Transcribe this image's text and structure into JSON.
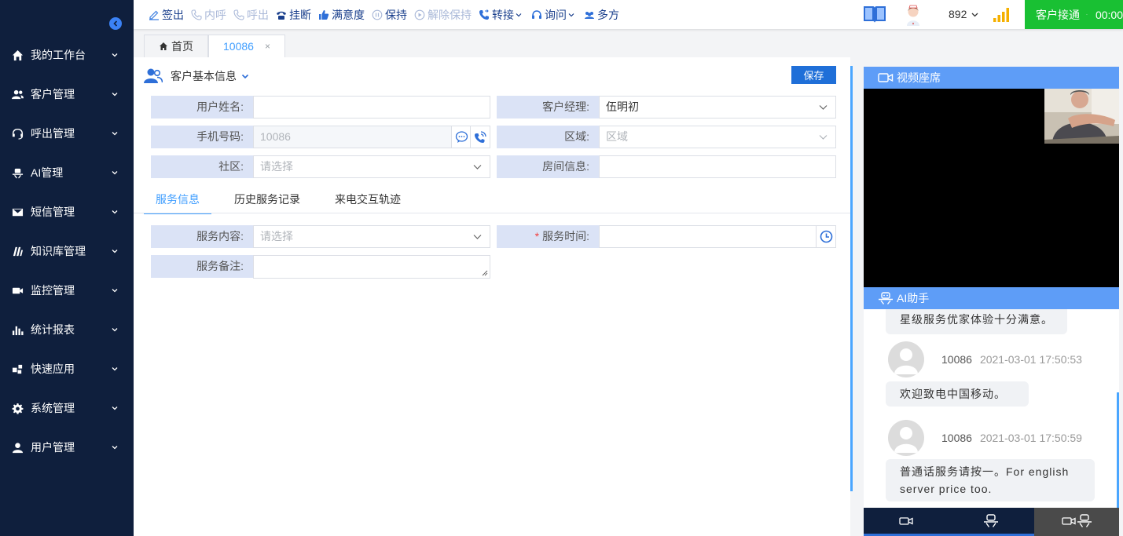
{
  "sidebar": {
    "items": [
      {
        "label": "我的工作台",
        "icon": "home-icon"
      },
      {
        "label": "客户管理",
        "icon": "users-icon"
      },
      {
        "label": "呼出管理",
        "icon": "headset-icon"
      },
      {
        "label": "AI管理",
        "icon": "ai-icon"
      },
      {
        "label": "短信管理",
        "icon": "mail-icon"
      },
      {
        "label": "知识库管理",
        "icon": "knowledge-icon"
      },
      {
        "label": "监控管理",
        "icon": "video-icon"
      },
      {
        "label": "统计报表",
        "icon": "bar-chart-icon"
      },
      {
        "label": "快速应用",
        "icon": "apps-icon"
      },
      {
        "label": "系统管理",
        "icon": "gear-icon"
      },
      {
        "label": "用户管理",
        "icon": "user-icon"
      }
    ]
  },
  "toolbar": {
    "signout": "签出",
    "internal_call": "内呼",
    "outbound_call": "呼出",
    "hangup": "挂断",
    "satisfaction": "满意度",
    "hold": "保持",
    "unhold": "解除保持",
    "transfer": "转接",
    "consult": "询问",
    "conference": "多方",
    "extension": "892",
    "status": "客户接通",
    "timer": "00:00"
  },
  "tabs": [
    {
      "label": "首页"
    },
    {
      "label": "10086",
      "close": "×"
    }
  ],
  "form": {
    "section_title": "客户基本信息",
    "save_label": "保存",
    "username_label": "用户姓名:",
    "username_value": "",
    "manager_label": "客户经理:",
    "manager_value": "伍明初",
    "phone_label": "手机号码:",
    "phone_value": "10086",
    "region_label": "区域:",
    "region_placeholder": "区域",
    "community_label": "社区:",
    "community_placeholder": "请选择",
    "room_label": "房间信息:",
    "room_value": ""
  },
  "sub_tabs": [
    "服务信息",
    "历史服务记录",
    "来电交互轨迹"
  ],
  "service": {
    "content_label": "服务内容:",
    "content_placeholder": "请选择",
    "required_mark": "*",
    "time_label": "服务时间:",
    "time_value": "",
    "remark_label": "服务备注:",
    "remark_value": ""
  },
  "right_panel": {
    "video_title": "视频座席",
    "ai_title": "AI助手",
    "messages": [
      {
        "text": "星级服务优家体验十分满意。"
      },
      {
        "name": "10086",
        "time": "2021-03-01 17:50:53",
        "text": "欢迎致电中国移动。"
      },
      {
        "name": "10086",
        "time": "2021-03-01 17:50:59",
        "text": "普通话服务请按一。For english server price too."
      }
    ]
  },
  "colors": {
    "sidebar_bg": "#0f1f3d",
    "accent": "#409eff",
    "status_green": "#19c033",
    "panel_header": "#5e9df7"
  }
}
